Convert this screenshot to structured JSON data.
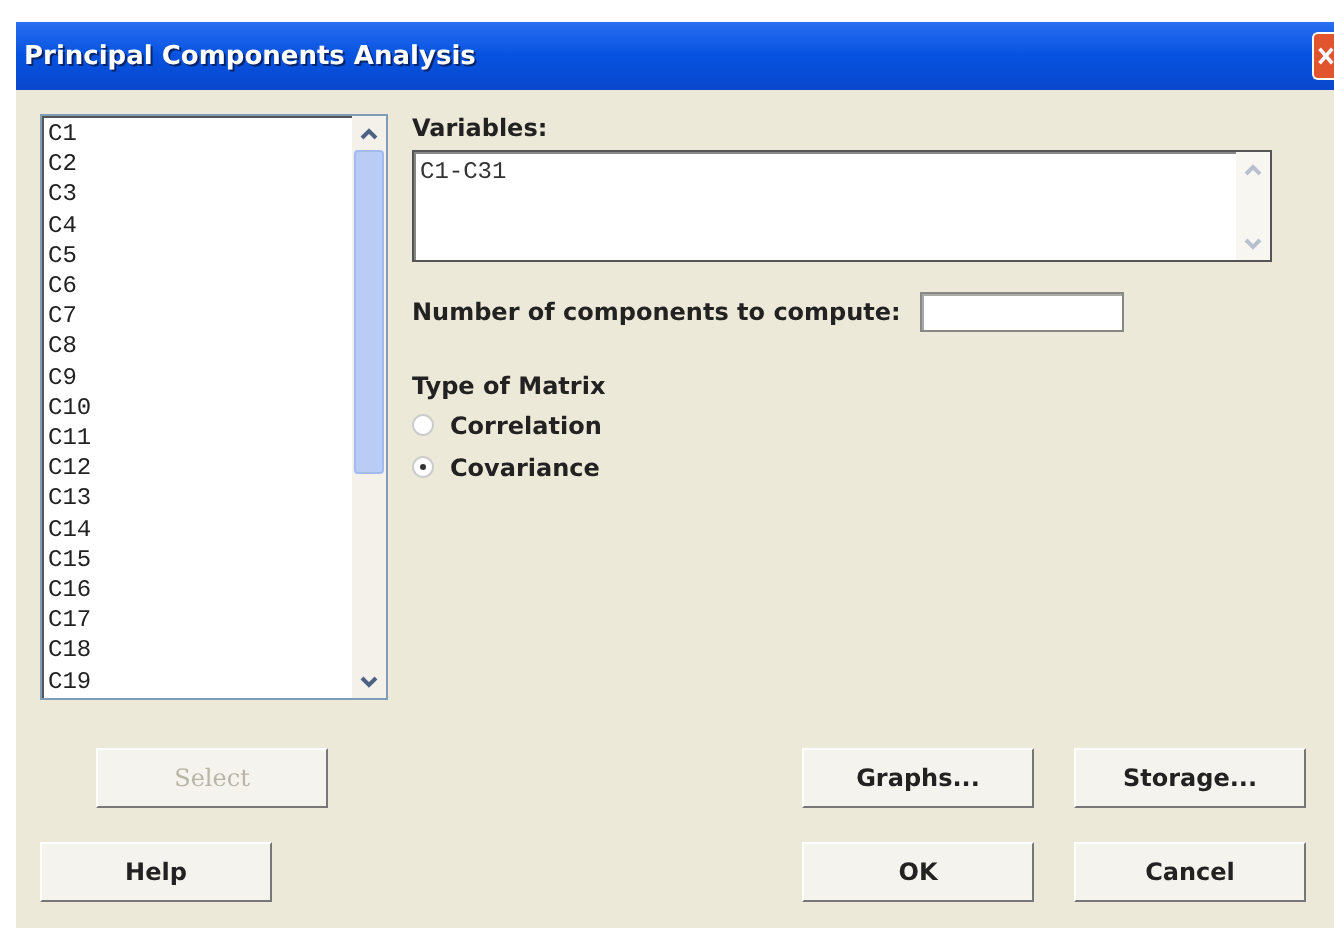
{
  "window": {
    "title": "Principal Components Analysis"
  },
  "columns_list": {
    "items": [
      "C1",
      "C2",
      "C3",
      "C4",
      "C5",
      "C6",
      "C7",
      "C8",
      "C9",
      "C10",
      "C11",
      "C12",
      "C13",
      "C14",
      "C15",
      "C16",
      "C17",
      "C18",
      "C19"
    ]
  },
  "variables": {
    "label": "Variables:",
    "value": "C1-C31"
  },
  "components": {
    "label": "Number of components to compute:"
  },
  "matrix_type": {
    "label": "Type of Matrix",
    "options": [
      {
        "label": "Correlation",
        "selected": false
      },
      {
        "label": "Covariance",
        "selected": true
      }
    ]
  },
  "buttons_top": [
    {
      "label": "Select",
      "disabled": true,
      "kind": "left"
    },
    {
      "label": "Graphs...",
      "disabled": false,
      "kind": "right"
    },
    {
      "label": "Storage...",
      "disabled": false,
      "kind": "right"
    }
  ],
  "buttons_bottom": [
    {
      "label": "Help",
      "disabled": false,
      "kind": "left"
    },
    {
      "label": "OK",
      "disabled": false,
      "kind": "right"
    },
    {
      "label": "Cancel",
      "disabled": false,
      "kind": "right"
    }
  ]
}
